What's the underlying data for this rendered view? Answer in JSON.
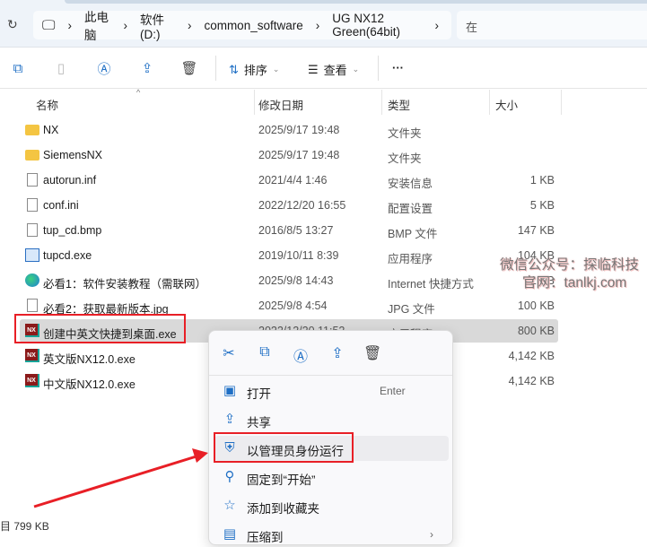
{
  "breadcrumb": [
    "此电脑",
    "软件 (D:)",
    "common_software",
    "UG NX12 Green(64bit)"
  ],
  "search_partial": "在",
  "toolbar": {
    "sort": "排序",
    "view": "查看",
    "more": "···"
  },
  "columns": {
    "name": "名称",
    "date": "修改日期",
    "type": "类型",
    "size": "大小"
  },
  "files": [
    {
      "name": "NX",
      "date": "2025/9/17 19:48",
      "type": "文件夹",
      "size": "",
      "icon": "folder"
    },
    {
      "name": "SiemensNX",
      "date": "2025/9/17 19:48",
      "type": "文件夹",
      "size": "",
      "icon": "folder"
    },
    {
      "name": "autorun.inf",
      "date": "2021/4/4 1:46",
      "type": "安装信息",
      "size": "1 KB",
      "icon": "file"
    },
    {
      "name": "conf.ini",
      "date": "2022/12/20 16:55",
      "type": "配置设置",
      "size": "5 KB",
      "icon": "file"
    },
    {
      "name": "tup_cd.bmp",
      "date": "2016/8/5 13:27",
      "type": "BMP 文件",
      "size": "147 KB",
      "icon": "file"
    },
    {
      "name": "tupcd.exe",
      "date": "2019/10/11 8:39",
      "type": "应用程序",
      "size": "104 KB",
      "icon": "exe"
    },
    {
      "name": "必看1：软件安装教程（需联网）",
      "date": "2025/9/8 14:43",
      "type": "Internet 快捷方式",
      "size": "1 KB",
      "icon": "edge"
    },
    {
      "name": "必看2：获取最新版本.jpg",
      "date": "2025/9/8 4:54",
      "type": "JPG 文件",
      "size": "100 KB",
      "icon": "file"
    },
    {
      "name": "创建中英文快捷到桌面.exe",
      "date": "2022/12/20 11:52",
      "type": "应用程序",
      "size": "800 KB",
      "icon": "nx"
    },
    {
      "name": "英文版NX12.0.exe",
      "date": "",
      "type": "",
      "size": "4,142 KB",
      "icon": "nx"
    },
    {
      "name": "中文版NX12.0.exe",
      "date": "",
      "type": "",
      "size": "4,142 KB",
      "icon": "nx"
    }
  ],
  "menu": {
    "items": [
      {
        "label": "打开",
        "key": "Enter",
        "icon": "▣"
      },
      {
        "label": "共享",
        "key": "",
        "icon": "⇪"
      },
      {
        "label": "以管理员身份运行",
        "key": "",
        "icon": "⛨"
      },
      {
        "label": "固定到“开始”",
        "key": "",
        "icon": "⚲"
      },
      {
        "label": "添加到收藏夹",
        "key": "",
        "icon": "☆"
      },
      {
        "label": "压缩到",
        "key": "›",
        "icon": "▤"
      }
    ]
  },
  "watermark": {
    "line1": "微信公众号：探临科技",
    "line2": "官网：tanlkj.com"
  },
  "status": "目  799 KB"
}
